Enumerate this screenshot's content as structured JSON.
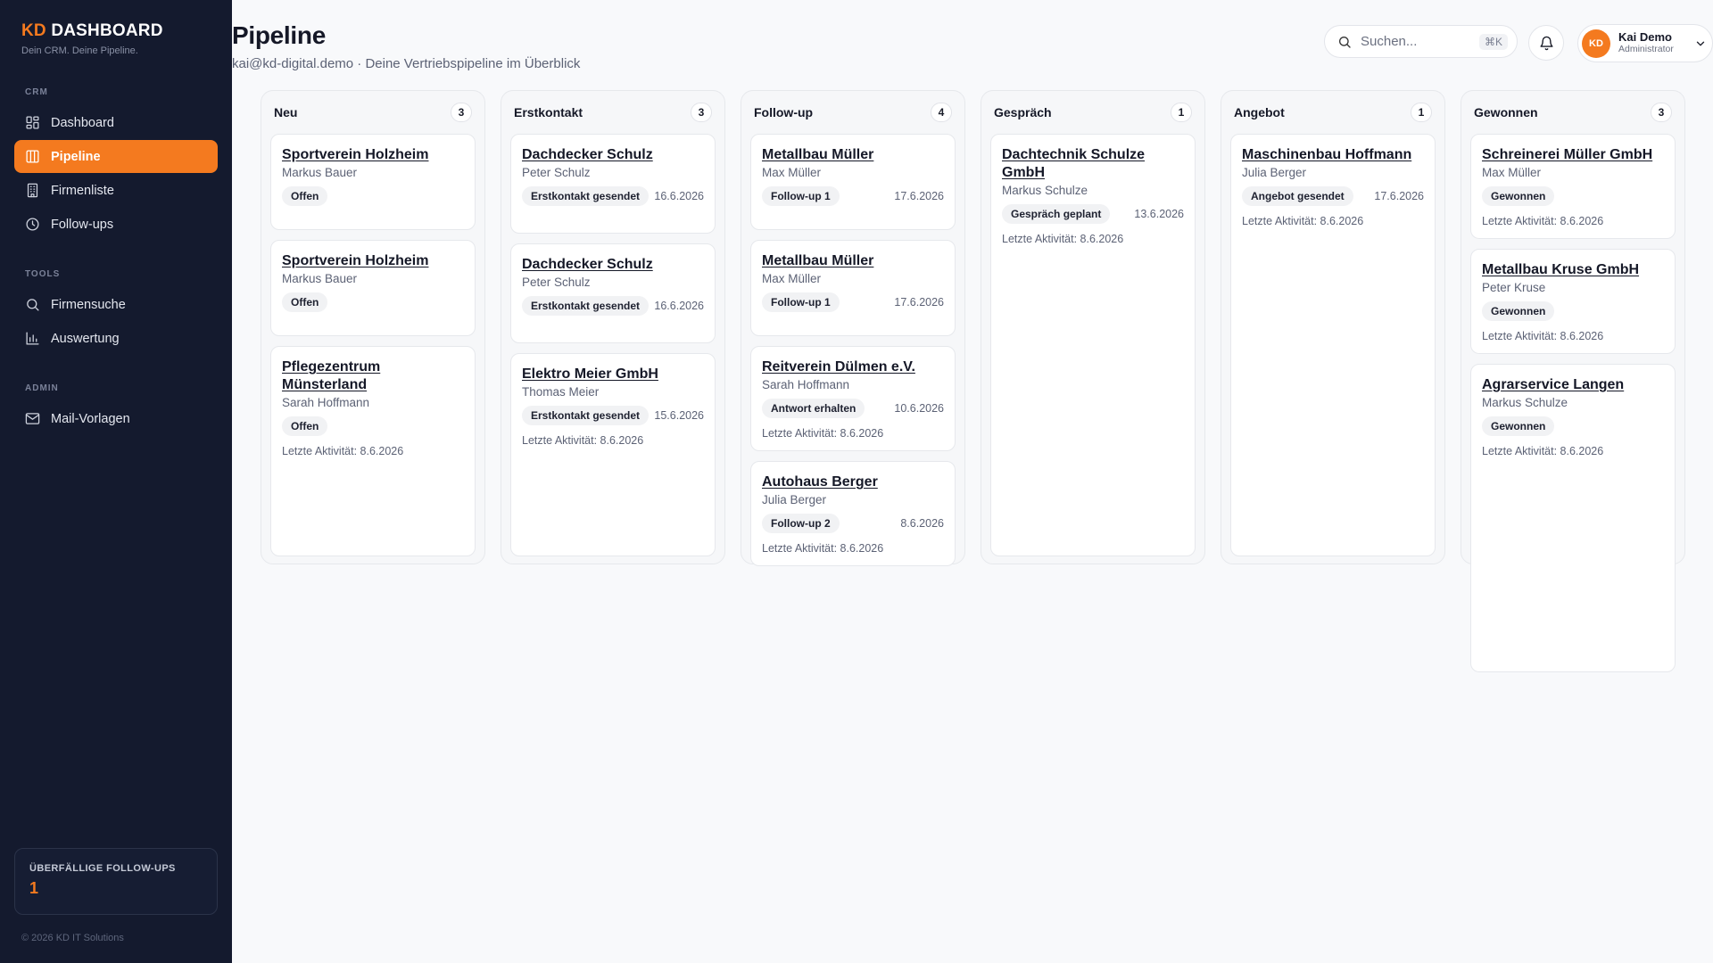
{
  "brand": {
    "prefix": "KD",
    "name": "DASHBOARD",
    "tagline": "Dein CRM. Deine Pipeline."
  },
  "sidebar": {
    "sections": [
      {
        "label": "CRM",
        "items": [
          {
            "label": "Dashboard",
            "icon": "dashboard-icon"
          },
          {
            "label": "Pipeline",
            "icon": "pipeline-icon",
            "active": true
          },
          {
            "label": "Firmenliste",
            "icon": "building-icon"
          },
          {
            "label": "Follow-ups",
            "icon": "clock-icon"
          }
        ]
      },
      {
        "label": "TOOLS",
        "items": [
          {
            "label": "Firmensuche",
            "icon": "search-icon"
          },
          {
            "label": "Auswertung",
            "icon": "chart-icon"
          }
        ]
      },
      {
        "label": "ADMIN",
        "items": [
          {
            "label": "Mail-Vorlagen",
            "icon": "mail-icon"
          }
        ]
      }
    ],
    "overdue": {
      "label": "ÜBERFÄLLIGE FOLLOW-UPS",
      "count": "1"
    },
    "footer": "© 2026 KD IT Solutions"
  },
  "header": {
    "title": "Pipeline",
    "subtitle": "kai@kd-digital.demo · Deine Vertriebspipeline im Überblick",
    "search_placeholder": "Suchen...",
    "search_shortcut": "⌘K",
    "user": {
      "initials": "KD",
      "name": "Kai Demo",
      "role": "Administrator"
    }
  },
  "colors": {
    "accent": "#f47a1f",
    "sidebar_bg": "#141a2e"
  },
  "columns": [
    {
      "title": "Neu",
      "count": "3",
      "cards": [
        {
          "title": "Sportverein Holzheim",
          "contact": "Markus Bauer",
          "badge": "Offen",
          "date": "",
          "activity": ""
        },
        {
          "title": "Sportverein Holzheim",
          "contact": "Markus Bauer",
          "badge": "Offen",
          "date": "",
          "activity": ""
        },
        {
          "title": "Pflegezentrum Münsterland",
          "contact": "Sarah Hoffmann",
          "badge": "Offen",
          "date": "",
          "activity": "Letzte Aktivität: 8.6.2026"
        }
      ]
    },
    {
      "title": "Erstkontakt",
      "count": "3",
      "cards": [
        {
          "title": "Dachdecker Schulz",
          "contact": "Peter Schulz",
          "badge": "Erstkontakt gesendet",
          "date": "16.6.2026",
          "activity": ""
        },
        {
          "title": "Dachdecker Schulz",
          "contact": "Peter Schulz",
          "badge": "Erstkontakt gesendet",
          "date": "16.6.2026",
          "activity": ""
        },
        {
          "title": "Elektro Meier GmbH",
          "contact": "Thomas Meier",
          "badge": "Erstkontakt gesendet",
          "date": "15.6.2026",
          "activity": "Letzte Aktivität: 8.6.2026"
        }
      ]
    },
    {
      "title": "Follow-up",
      "count": "4",
      "cards": [
        {
          "title": "Metallbau Müller",
          "contact": "Max Müller",
          "badge": "Follow-up 1",
          "date": "17.6.2026",
          "activity": ""
        },
        {
          "title": "Metallbau Müller",
          "contact": "Max Müller",
          "badge": "Follow-up 1",
          "date": "17.6.2026",
          "activity": ""
        },
        {
          "title": "Reitverein Dülmen e.V.",
          "contact": "Sarah Hoffmann",
          "badge": "Antwort erhalten",
          "date": "10.6.2026",
          "activity": "Letzte Aktivität: 8.6.2026"
        },
        {
          "title": "Autohaus Berger",
          "contact": "Julia Berger",
          "badge": "Follow-up 2",
          "date": "8.6.2026",
          "activity": "Letzte Aktivität: 8.6.2026"
        }
      ]
    },
    {
      "title": "Gespräch",
      "count": "1",
      "cards": [
        {
          "title": "Dachtechnik Schulze GmbH",
          "contact": "Markus Schulze",
          "badge": "Gespräch geplant",
          "date": "13.6.2026",
          "activity": "Letzte Aktivität: 8.6.2026"
        }
      ]
    },
    {
      "title": "Angebot",
      "count": "1",
      "cards": [
        {
          "title": "Maschinenbau Hoffmann",
          "contact": "Julia Berger",
          "badge": "Angebot gesendet",
          "date": "17.6.2026",
          "activity": "Letzte Aktivität: 8.6.2026"
        }
      ]
    },
    {
      "title": "Gewonnen",
      "count": "3",
      "cards": [
        {
          "title": "Schreinerei Müller GmbH",
          "contact": "Max Müller",
          "badge": "Gewonnen",
          "date": "",
          "activity": "Letzte Aktivität: 8.6.2026"
        },
        {
          "title": "Metallbau Kruse GmbH",
          "contact": "Peter Kruse",
          "badge": "Gewonnen",
          "date": "",
          "activity": "Letzte Aktivität: 8.6.2026"
        },
        {
          "title": "Agrarservice Langen",
          "contact": "Markus Schulze",
          "badge": "Gewonnen",
          "date": "",
          "activity": "Letzte Aktivität: 8.6.2026"
        }
      ]
    }
  ]
}
